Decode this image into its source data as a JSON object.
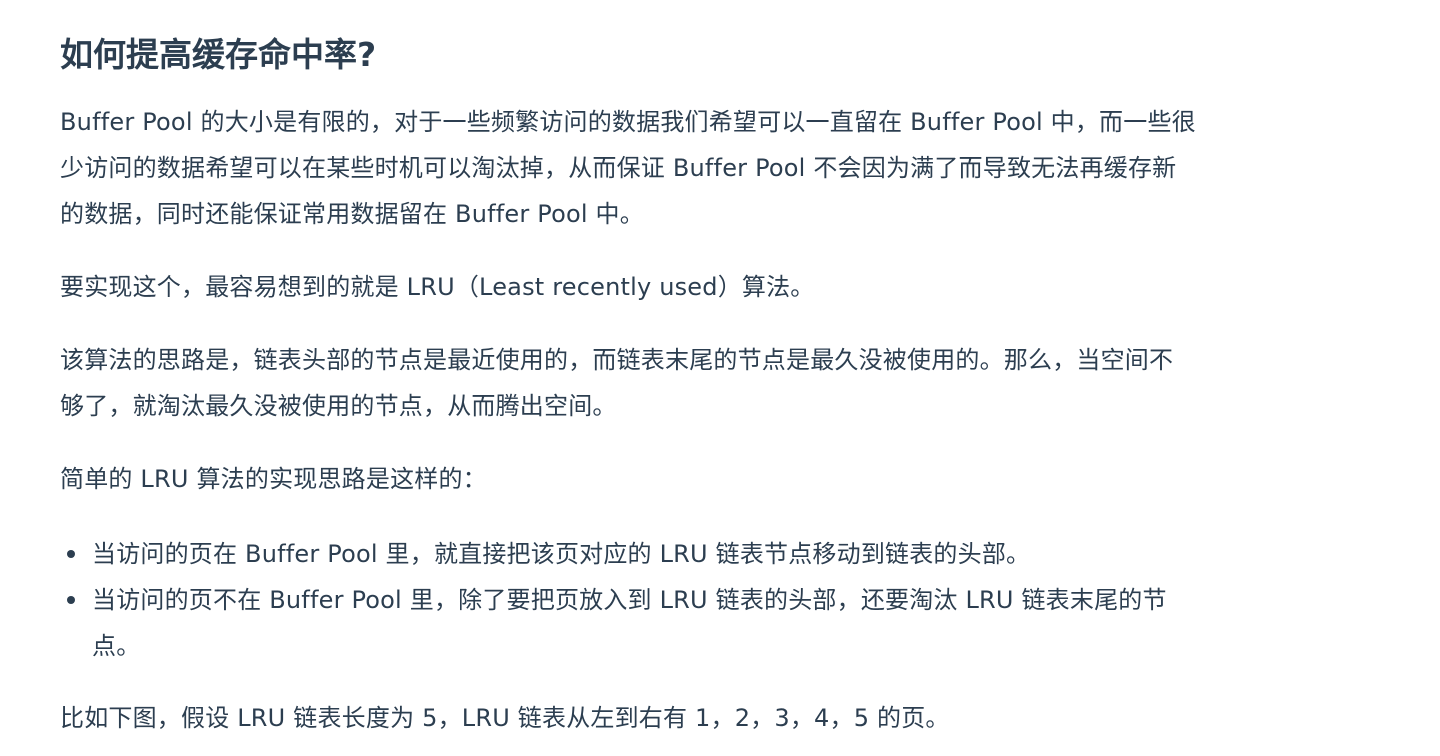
{
  "heading": "如何提高缓存命中率?",
  "para1": {
    "lines": [
      "Buffer Pool 的大小是有限的，对于一些频繁访问的数据我们希望可以一直留在 Buffer Pool 中，而一些很",
      "少访问的数据希望可以在某些时机可以淘汰掉，从而保证 Buffer Pool 不会因为满了而导致无法再缓存新",
      "的数据，同时还能保证常用数据留在 Buffer Pool 中。"
    ]
  },
  "para2": {
    "lines": [
      "要实现这个，最容易想到的就是 LRU（Least recently used）算法。"
    ]
  },
  "para3": {
    "lines": [
      "该算法的思路是，链表头部的节点是最近使用的，而链表末尾的节点是最久没被使用的。那么，当空间不",
      "够了，就淘汰最久没被使用的节点，从而腾出空间。"
    ]
  },
  "para4": {
    "lines": [
      "简单的 LRU 算法的实现思路是这样的："
    ]
  },
  "bullets": [
    {
      "lines": [
        "当访问的页在 Buffer Pool 里，就直接把该页对应的 LRU 链表节点移动到链表的头部。"
      ]
    },
    {
      "lines": [
        "当访问的页不在 Buffer Pool 里，除了要把页放入到 LRU 链表的头部，还要淘汰 LRU 链表末尾的节",
        "点。"
      ]
    }
  ],
  "para5": {
    "lines": [
      "比如下图，假设 LRU 链表长度为 5，LRU 链表从左到右有 1，2，3，4，5 的页。"
    ]
  }
}
